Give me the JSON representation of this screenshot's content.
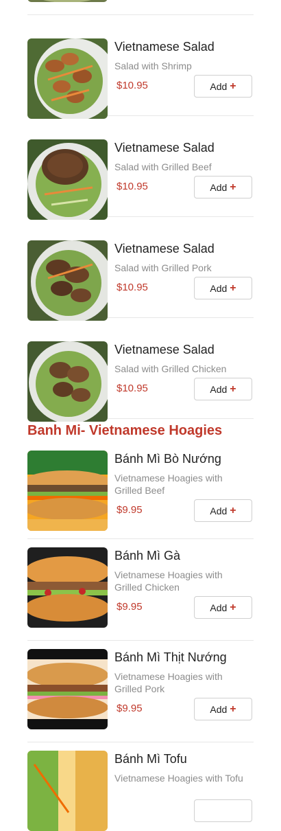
{
  "sections": [
    {
      "title": "",
      "items": [
        {
          "name": "Vietnamese Salad",
          "description": "Salad with Shrimp",
          "price": "$10.95",
          "add_label": "Add"
        },
        {
          "name": "Vietnamese Salad",
          "description": "Salad with Grilled Beef",
          "price": "$10.95",
          "add_label": "Add"
        },
        {
          "name": "Vietnamese Salad",
          "description": "Salad with Grilled Pork",
          "price": "$10.95",
          "add_label": "Add"
        },
        {
          "name": "Vietnamese Salad",
          "description": "Salad with Grilled Chicken",
          "price": "$10.95",
          "add_label": "Add"
        }
      ]
    },
    {
      "title": "Banh Mi- Vietnamese Hoagies",
      "items": [
        {
          "name": "Bánh Mì Bò Nướng",
          "description": "Vietnamese Hoagies with Grilled Beef",
          "price": "$9.95",
          "add_label": "Add"
        },
        {
          "name": "Bánh Mì Gà",
          "description": "Vietnamese Hoagies with Grilled Chicken",
          "price": "$9.95",
          "add_label": "Add"
        },
        {
          "name": "Bánh Mì Thịt Nướng",
          "description": "Vietnamese Hoagies with Grilled Pork",
          "price": "$9.95",
          "add_label": "Add"
        },
        {
          "name": "Bánh Mì Tofu",
          "description": "Vietnamese Hoagies with Tofu",
          "price": "",
          "add_label": ""
        }
      ]
    }
  ],
  "colors": {
    "accent": "#c0392b",
    "divider": "#e7e7e7"
  },
  "icons": {
    "add": "plus-icon"
  }
}
